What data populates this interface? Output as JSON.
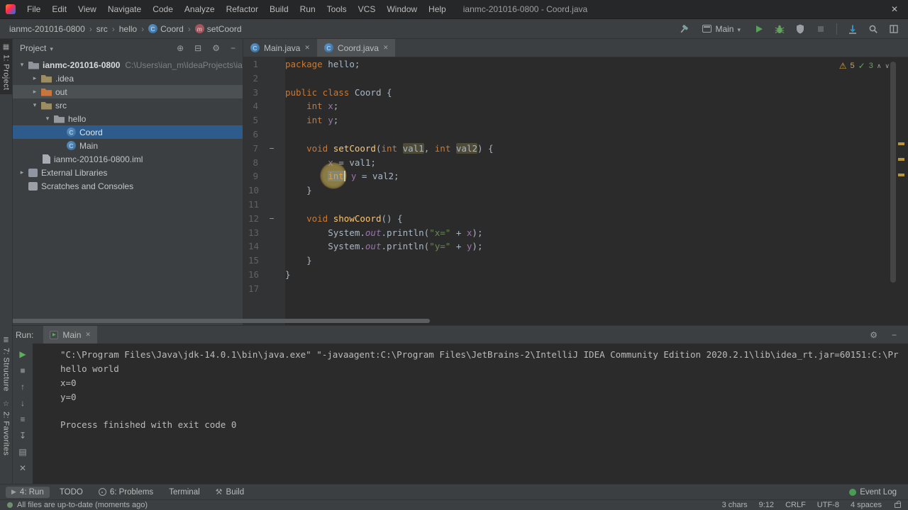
{
  "menu_bar": {
    "items": [
      "File",
      "Edit",
      "View",
      "Navigate",
      "Code",
      "Analyze",
      "Refactor",
      "Build",
      "Run",
      "Tools",
      "VCS",
      "Window",
      "Help"
    ],
    "window_title": "ianmc-201016-0800 - Coord.java"
  },
  "toolbar": {
    "breadcrumbs": [
      {
        "label": "ianmc-201016-0800"
      },
      {
        "label": "src"
      },
      {
        "label": "hello"
      },
      {
        "label": "Coord",
        "icon": "class"
      },
      {
        "label": "setCoord",
        "icon": "method"
      }
    ],
    "run_config": "Main"
  },
  "tool_buttons": {
    "project": "1: Project",
    "structure": "7: Structure",
    "favorites": "2: Favorites"
  },
  "project_panel": {
    "title": "Project",
    "tree": [
      {
        "depth": 0,
        "expanded": true,
        "icon": "folder-root",
        "label": "ianmc-201016-0800",
        "path": "C:\\Users\\ian_m\\IdeaProjects\\ianmc",
        "bold": true
      },
      {
        "depth": 1,
        "expanded": false,
        "icon": "folder",
        "label": ".idea"
      },
      {
        "depth": 1,
        "expanded": false,
        "icon": "folder-excluded",
        "label": "out",
        "hover": true
      },
      {
        "depth": 1,
        "expanded": true,
        "icon": "folder-src",
        "label": "src"
      },
      {
        "depth": 2,
        "expanded": true,
        "icon": "package",
        "label": "hello"
      },
      {
        "depth": 3,
        "icon": "class",
        "label": "Coord",
        "selected": true
      },
      {
        "depth": 3,
        "icon": "class",
        "label": "Main"
      },
      {
        "depth": 1,
        "icon": "file",
        "label": "ianmc-201016-0800.iml"
      },
      {
        "depth": 0,
        "expanded": false,
        "icon": "library",
        "label": "External Libraries"
      },
      {
        "depth": 0,
        "icon": "scratches",
        "label": "Scratches and Consoles"
      }
    ]
  },
  "editor": {
    "tabs": [
      {
        "label": "Main.java",
        "active": false
      },
      {
        "label": "Coord.java",
        "active": true
      }
    ],
    "inspections": {
      "warnings": "5",
      "passed": "3"
    },
    "code": [
      {
        "n": "1",
        "seg": [
          [
            "kw",
            "package"
          ],
          [
            "pl",
            " hello;"
          ]
        ]
      },
      {
        "n": "2",
        "seg": []
      },
      {
        "n": "3",
        "seg": [
          [
            "kw",
            "public class"
          ],
          [
            "pl",
            " "
          ],
          [
            "cl",
            "Coord"
          ],
          [
            "pl",
            " {"
          ]
        ]
      },
      {
        "n": "4",
        "seg": [
          [
            "pl",
            "    "
          ],
          [
            "kw",
            "int"
          ],
          [
            "pl",
            " "
          ],
          [
            "fd",
            "x"
          ],
          [
            "pl",
            ";"
          ]
        ]
      },
      {
        "n": "5",
        "seg": [
          [
            "pl",
            "    "
          ],
          [
            "kw",
            "int"
          ],
          [
            "pl",
            " "
          ],
          [
            "fd",
            "y"
          ],
          [
            "pl",
            ";"
          ]
        ]
      },
      {
        "n": "6",
        "seg": []
      },
      {
        "n": "7",
        "fold": true,
        "seg": [
          [
            "pl",
            "    "
          ],
          [
            "kw",
            "void"
          ],
          [
            "pl",
            " "
          ],
          [
            "mtd",
            "setCoord"
          ],
          [
            "pl",
            "("
          ],
          [
            "kw",
            "int"
          ],
          [
            "pl",
            " "
          ],
          [
            "hl",
            "val1"
          ],
          [
            "pl",
            ", "
          ],
          [
            "kw",
            "int"
          ],
          [
            "pl",
            " "
          ],
          [
            "hl",
            "val2"
          ],
          [
            "pl",
            ") {"
          ]
        ]
      },
      {
        "n": "8",
        "seg": [
          [
            "pl",
            "        "
          ],
          [
            "fd",
            "x"
          ],
          [
            "pl",
            " = val1;"
          ]
        ]
      },
      {
        "n": "9",
        "seg": [
          [
            "pl",
            "        "
          ],
          [
            "sel",
            "int"
          ],
          [
            "caret",
            ""
          ],
          [
            "pl",
            " "
          ],
          [
            "fd",
            "y"
          ],
          [
            "pl",
            " = val2;"
          ]
        ]
      },
      {
        "n": "10",
        "seg": [
          [
            "pl",
            "    }"
          ]
        ]
      },
      {
        "n": "11",
        "seg": []
      },
      {
        "n": "12",
        "fold": true,
        "seg": [
          [
            "pl",
            "    "
          ],
          [
            "kw",
            "void"
          ],
          [
            "pl",
            " "
          ],
          [
            "mtd",
            "showCoord"
          ],
          [
            "pl",
            "() {"
          ]
        ]
      },
      {
        "n": "13",
        "seg": [
          [
            "pl",
            "        System."
          ],
          [
            "fdi",
            "out"
          ],
          [
            "pl",
            ".println("
          ],
          [
            "st",
            "\"x=\""
          ],
          [
            "pl",
            " + "
          ],
          [
            "fd",
            "x"
          ],
          [
            "pl",
            ");"
          ]
        ]
      },
      {
        "n": "14",
        "seg": [
          [
            "pl",
            "        System."
          ],
          [
            "fdi",
            "out"
          ],
          [
            "pl",
            ".println("
          ],
          [
            "st",
            "\"y=\""
          ],
          [
            "pl",
            " + "
          ],
          [
            "fd",
            "y"
          ],
          [
            "pl",
            ");"
          ]
        ]
      },
      {
        "n": "15",
        "seg": [
          [
            "pl",
            "    }"
          ]
        ]
      },
      {
        "n": "16",
        "seg": [
          [
            "pl",
            "}"
          ]
        ]
      },
      {
        "n": "17",
        "seg": []
      }
    ]
  },
  "run_panel": {
    "label": "Run:",
    "tab_label": "Main",
    "console": [
      "\"C:\\Program Files\\Java\\jdk-14.0.1\\bin\\java.exe\" \"-javaagent:C:\\Program Files\\JetBrains-2\\IntelliJ IDEA Community Edition 2020.2.1\\lib\\idea_rt.jar=60151:C:\\Pr",
      "hello world",
      "x=0",
      "y=0",
      "",
      "Process finished with exit code 0"
    ]
  },
  "bottom_stripe": {
    "left": [
      {
        "icon": "run",
        "label": "4: Run",
        "active": true
      },
      {
        "label": "TODO"
      },
      {
        "icon": "problems",
        "label": "6: Problems"
      },
      {
        "label": "Terminal"
      },
      {
        "icon": "build",
        "label": "Build"
      }
    ],
    "right": [
      {
        "icon": "event-log",
        "label": "Event Log"
      }
    ]
  },
  "status_bar": {
    "message": "All files are up-to-date (moments ago)",
    "widgets": [
      "3 chars",
      "9:12",
      "CRLF",
      "UTF-8",
      "4 spaces"
    ]
  }
}
